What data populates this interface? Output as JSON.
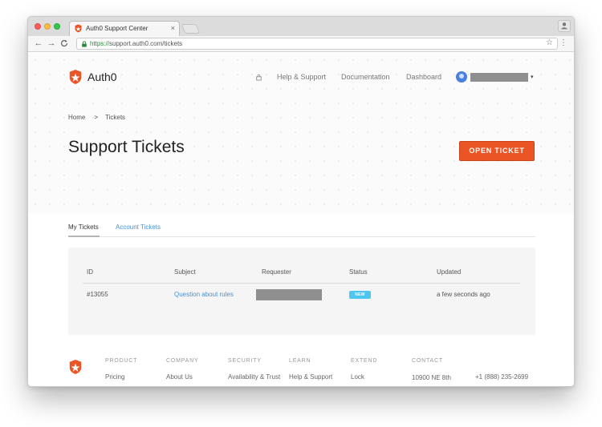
{
  "browser": {
    "tab_title": "Auth0 Support Center",
    "tab_close": "×",
    "url_scheme": "https://",
    "url_rest": "support.auth0.com/tickets",
    "star": "☆",
    "menu": "⋮",
    "back": "←",
    "forward": "→",
    "reload": "C"
  },
  "header": {
    "logo_text": "Auth0",
    "nav": [
      "Help & Support",
      "Documentation",
      "Dashboard"
    ],
    "user_caret": "▾"
  },
  "breadcrumb": {
    "home": "Home",
    "separator": ">",
    "current": "Tickets"
  },
  "page_title": "Support Tickets",
  "open_ticket_label": "OPEN TICKET",
  "tabs": {
    "my": "My Tickets",
    "account": "Account Tickets"
  },
  "table": {
    "headers": [
      "ID",
      "Subject",
      "Requester",
      "Status",
      "Updated"
    ],
    "rows": [
      {
        "id": "#13055",
        "subject": "Question about rules",
        "status": "NEW",
        "updated": "a few seconds ago"
      }
    ]
  },
  "footer": {
    "columns": [
      {
        "heading": "PRODUCT",
        "link": "Pricing"
      },
      {
        "heading": "COMPANY",
        "link": "About Us"
      },
      {
        "heading": "SECURITY",
        "link": "Availability & Trust"
      },
      {
        "heading": "LEARN",
        "link": "Help & Support"
      },
      {
        "heading": "EXTEND",
        "link": "Lock"
      },
      {
        "heading": "CONTACT",
        "link": "10900 NE 8th"
      }
    ],
    "phone": "+1 (888) 235-2699"
  },
  "colors": {
    "brand": "#eb5424",
    "link": "#4d8fd1",
    "badge": "#4dc7f0"
  }
}
